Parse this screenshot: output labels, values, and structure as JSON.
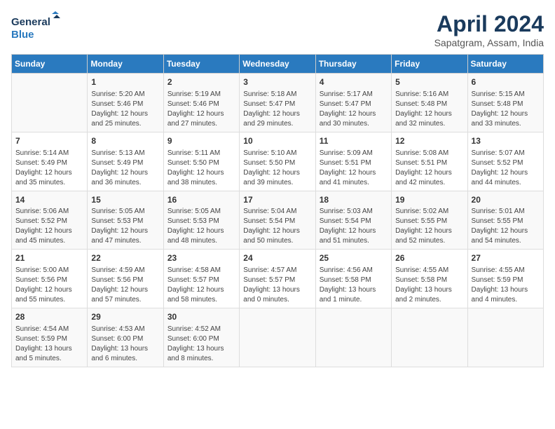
{
  "header": {
    "logo_line1": "General",
    "logo_line2": "Blue",
    "month_title": "April 2024",
    "subtitle": "Sapatgram, Assam, India"
  },
  "columns": [
    "Sunday",
    "Monday",
    "Tuesday",
    "Wednesday",
    "Thursday",
    "Friday",
    "Saturday"
  ],
  "weeks": [
    [
      {
        "date": "",
        "info": ""
      },
      {
        "date": "1",
        "info": "Sunrise: 5:20 AM\nSunset: 5:46 PM\nDaylight: 12 hours\nand 25 minutes."
      },
      {
        "date": "2",
        "info": "Sunrise: 5:19 AM\nSunset: 5:46 PM\nDaylight: 12 hours\nand 27 minutes."
      },
      {
        "date": "3",
        "info": "Sunrise: 5:18 AM\nSunset: 5:47 PM\nDaylight: 12 hours\nand 29 minutes."
      },
      {
        "date": "4",
        "info": "Sunrise: 5:17 AM\nSunset: 5:47 PM\nDaylight: 12 hours\nand 30 minutes."
      },
      {
        "date": "5",
        "info": "Sunrise: 5:16 AM\nSunset: 5:48 PM\nDaylight: 12 hours\nand 32 minutes."
      },
      {
        "date": "6",
        "info": "Sunrise: 5:15 AM\nSunset: 5:48 PM\nDaylight: 12 hours\nand 33 minutes."
      }
    ],
    [
      {
        "date": "7",
        "info": "Sunrise: 5:14 AM\nSunset: 5:49 PM\nDaylight: 12 hours\nand 35 minutes."
      },
      {
        "date": "8",
        "info": "Sunrise: 5:13 AM\nSunset: 5:49 PM\nDaylight: 12 hours\nand 36 minutes."
      },
      {
        "date": "9",
        "info": "Sunrise: 5:11 AM\nSunset: 5:50 PM\nDaylight: 12 hours\nand 38 minutes."
      },
      {
        "date": "10",
        "info": "Sunrise: 5:10 AM\nSunset: 5:50 PM\nDaylight: 12 hours\nand 39 minutes."
      },
      {
        "date": "11",
        "info": "Sunrise: 5:09 AM\nSunset: 5:51 PM\nDaylight: 12 hours\nand 41 minutes."
      },
      {
        "date": "12",
        "info": "Sunrise: 5:08 AM\nSunset: 5:51 PM\nDaylight: 12 hours\nand 42 minutes."
      },
      {
        "date": "13",
        "info": "Sunrise: 5:07 AM\nSunset: 5:52 PM\nDaylight: 12 hours\nand 44 minutes."
      }
    ],
    [
      {
        "date": "14",
        "info": "Sunrise: 5:06 AM\nSunset: 5:52 PM\nDaylight: 12 hours\nand 45 minutes."
      },
      {
        "date": "15",
        "info": "Sunrise: 5:05 AM\nSunset: 5:53 PM\nDaylight: 12 hours\nand 47 minutes."
      },
      {
        "date": "16",
        "info": "Sunrise: 5:05 AM\nSunset: 5:53 PM\nDaylight: 12 hours\nand 48 minutes."
      },
      {
        "date": "17",
        "info": "Sunrise: 5:04 AM\nSunset: 5:54 PM\nDaylight: 12 hours\nand 50 minutes."
      },
      {
        "date": "18",
        "info": "Sunrise: 5:03 AM\nSunset: 5:54 PM\nDaylight: 12 hours\nand 51 minutes."
      },
      {
        "date": "19",
        "info": "Sunrise: 5:02 AM\nSunset: 5:55 PM\nDaylight: 12 hours\nand 52 minutes."
      },
      {
        "date": "20",
        "info": "Sunrise: 5:01 AM\nSunset: 5:55 PM\nDaylight: 12 hours\nand 54 minutes."
      }
    ],
    [
      {
        "date": "21",
        "info": "Sunrise: 5:00 AM\nSunset: 5:56 PM\nDaylight: 12 hours\nand 55 minutes."
      },
      {
        "date": "22",
        "info": "Sunrise: 4:59 AM\nSunset: 5:56 PM\nDaylight: 12 hours\nand 57 minutes."
      },
      {
        "date": "23",
        "info": "Sunrise: 4:58 AM\nSunset: 5:57 PM\nDaylight: 12 hours\nand 58 minutes."
      },
      {
        "date": "24",
        "info": "Sunrise: 4:57 AM\nSunset: 5:57 PM\nDaylight: 13 hours\nand 0 minutes."
      },
      {
        "date": "25",
        "info": "Sunrise: 4:56 AM\nSunset: 5:58 PM\nDaylight: 13 hours\nand 1 minute."
      },
      {
        "date": "26",
        "info": "Sunrise: 4:55 AM\nSunset: 5:58 PM\nDaylight: 13 hours\nand 2 minutes."
      },
      {
        "date": "27",
        "info": "Sunrise: 4:55 AM\nSunset: 5:59 PM\nDaylight: 13 hours\nand 4 minutes."
      }
    ],
    [
      {
        "date": "28",
        "info": "Sunrise: 4:54 AM\nSunset: 5:59 PM\nDaylight: 13 hours\nand 5 minutes."
      },
      {
        "date": "29",
        "info": "Sunrise: 4:53 AM\nSunset: 6:00 PM\nDaylight: 13 hours\nand 6 minutes."
      },
      {
        "date": "30",
        "info": "Sunrise: 4:52 AM\nSunset: 6:00 PM\nDaylight: 13 hours\nand 8 minutes."
      },
      {
        "date": "",
        "info": ""
      },
      {
        "date": "",
        "info": ""
      },
      {
        "date": "",
        "info": ""
      },
      {
        "date": "",
        "info": ""
      }
    ]
  ]
}
